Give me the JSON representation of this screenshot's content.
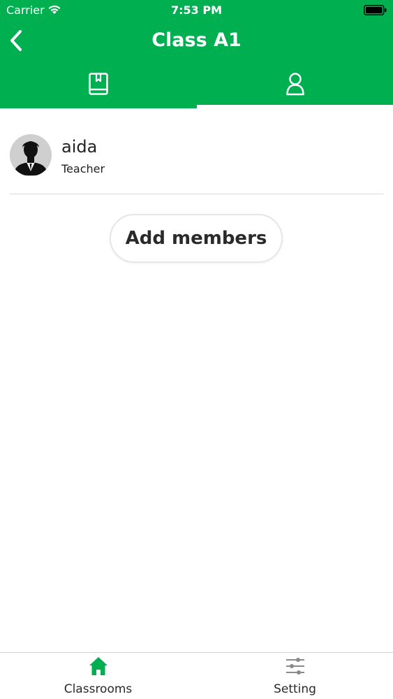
{
  "status_bar": {
    "carrier": "Carrier",
    "time": "7:53 PM"
  },
  "nav": {
    "title": "Class A1"
  },
  "tabs": [
    {
      "icon": "book-icon",
      "active": false
    },
    {
      "icon": "user-icon",
      "active": true
    }
  ],
  "members": [
    {
      "name": "aida",
      "role": "Teacher"
    }
  ],
  "add_members_label": "Add members",
  "bottom_tabs": [
    {
      "label": "Classrooms",
      "icon": "home-icon",
      "active": true
    },
    {
      "label": "Setting",
      "icon": "sliders-icon",
      "active": false
    }
  ],
  "colors": {
    "accent": "#00b050",
    "text": "#222222",
    "inactive_icon": "#8a8a8a"
  }
}
